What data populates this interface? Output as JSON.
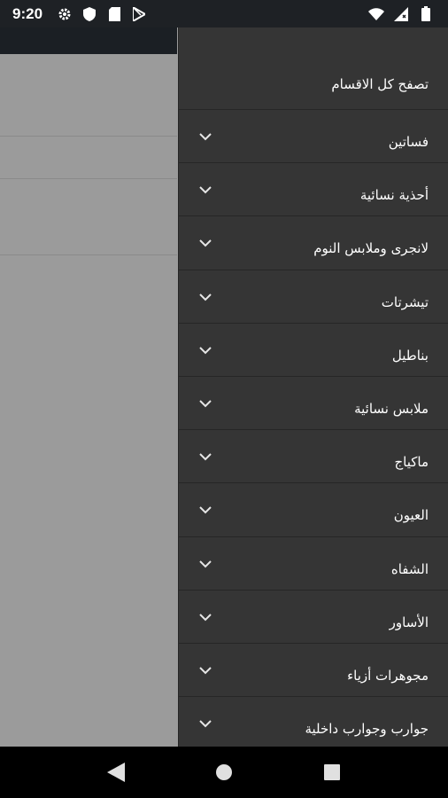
{
  "status_bar": {
    "time": "9:20",
    "left_icons": [
      "gear-icon",
      "shield-icon",
      "sd-card-icon",
      "play-store-icon"
    ],
    "right_icons": [
      "wifi-icon",
      "signal-icon",
      "battery-icon"
    ]
  },
  "drawer": {
    "header_label": "تصفح كل الاقسام",
    "items": [
      {
        "label": "فساتين"
      },
      {
        "label": "أحذية نسائية"
      },
      {
        "label": "لانجرى وملابس النوم"
      },
      {
        "label": "تيشرتات"
      },
      {
        "label": "بناطيل"
      },
      {
        "label": "ملابس نسائية"
      },
      {
        "label": "ماكياج"
      },
      {
        "label": "العيون"
      },
      {
        "label": "الشفاه"
      },
      {
        "label": "الأساور"
      },
      {
        "label": "مجوهرات أزياء"
      },
      {
        "label": "جوارب وجوارب داخلية"
      }
    ]
  },
  "nav_bar": {
    "buttons": [
      "back-icon",
      "home-icon",
      "recents-icon"
    ]
  },
  "colors": {
    "drawer_bg": "#353535",
    "scrim": "#9b9b9b",
    "status_bar": "#1e2125"
  }
}
